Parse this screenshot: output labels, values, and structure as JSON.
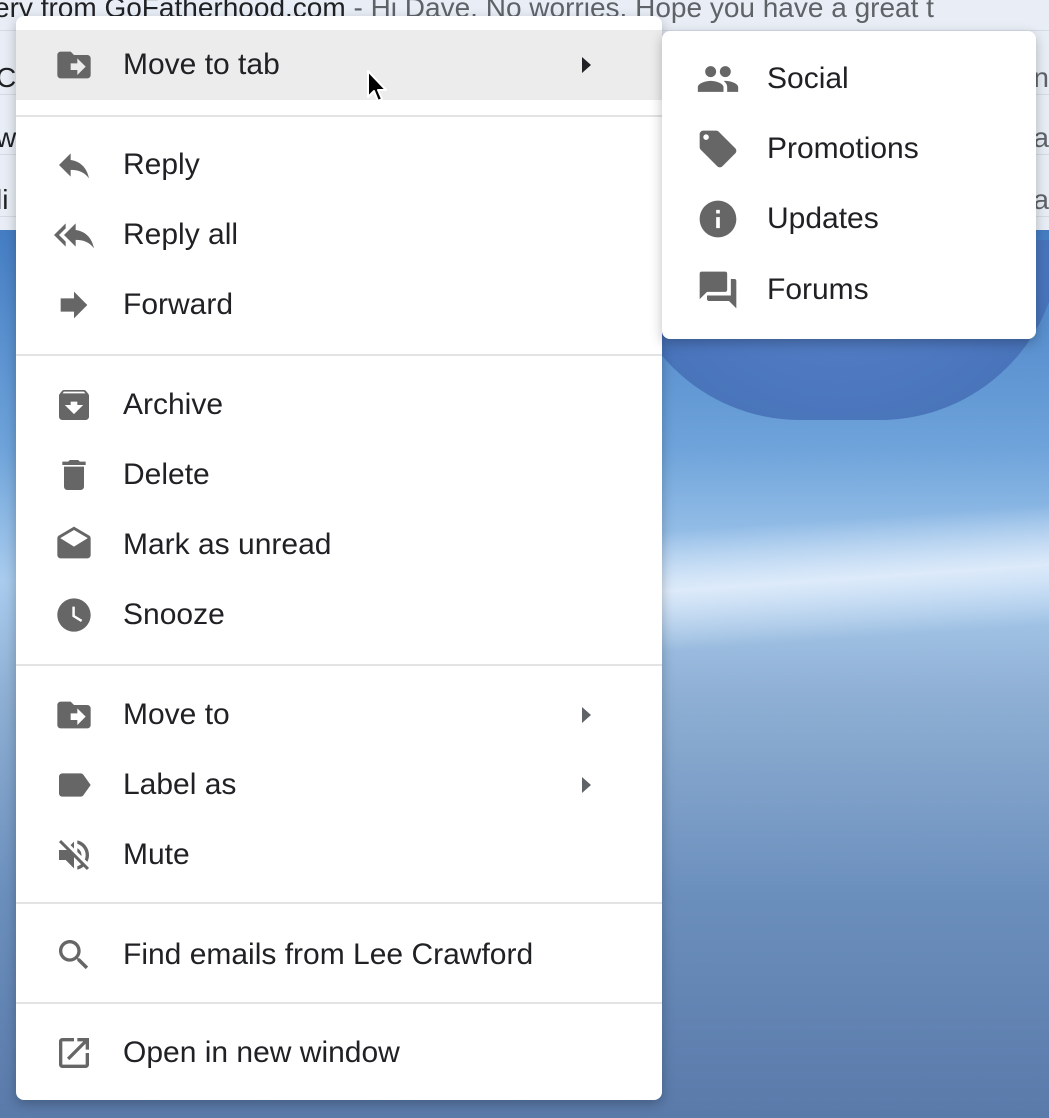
{
  "background": {
    "rows": [
      {
        "sender": "ery from GoFatherhood.com",
        "snippet": " - Hi Dave, No worries. Hope you have a great t",
        "right": ""
      },
      {
        "sender": "C",
        "snippet": "",
        "right": "n"
      },
      {
        "sender": "w",
        "snippet": "",
        "right": "a"
      },
      {
        "sender": "li",
        "snippet": "",
        "right": "a"
      }
    ]
  },
  "context_menu": {
    "move_to_tab": {
      "label": "Move to tab",
      "icon": "move-to-icon"
    },
    "reply": {
      "label": "Reply",
      "icon": "reply-icon"
    },
    "reply_all": {
      "label": "Reply all",
      "icon": "reply-all-icon"
    },
    "forward": {
      "label": "Forward",
      "icon": "forward-icon"
    },
    "archive": {
      "label": "Archive",
      "icon": "archive-icon"
    },
    "delete": {
      "label": "Delete",
      "icon": "trash-icon"
    },
    "mark_unread": {
      "label": "Mark as unread",
      "icon": "mark-unread-icon"
    },
    "snooze": {
      "label": "Snooze",
      "icon": "clock-icon"
    },
    "move_to": {
      "label": "Move to",
      "icon": "move-to-icon"
    },
    "label_as": {
      "label": "Label as",
      "icon": "label-icon"
    },
    "mute": {
      "label": "Mute",
      "icon": "mute-icon"
    },
    "find_emails": {
      "label": "Find emails from Lee Crawford",
      "icon": "search-icon"
    },
    "open_window": {
      "label": "Open in new window",
      "icon": "open-in-new-icon"
    }
  },
  "submenu": {
    "items": [
      {
        "label": "Social",
        "icon": "people-icon"
      },
      {
        "label": "Promotions",
        "icon": "tag-icon"
      },
      {
        "label": "Updates",
        "icon": "info-icon"
      },
      {
        "label": "Forums",
        "icon": "forum-icon"
      }
    ]
  },
  "colors": {
    "menu_bg": "#ffffff",
    "hover_bg": "#ececec",
    "icon": "#666666",
    "text": "#202124",
    "separator": "#e3e3e3"
  }
}
